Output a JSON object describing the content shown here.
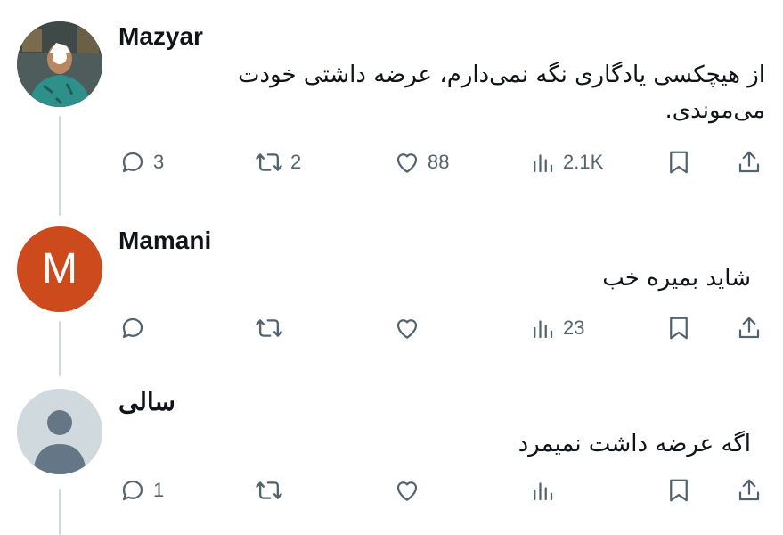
{
  "replies": [
    {
      "author": "Mazyar",
      "avatar_letter": "",
      "text_line1": "از هیچکسی یادگاری نگه نمی‌دارم، عرضه داشتی خودت",
      "text_line2": "می‌موندی.",
      "counts": {
        "reply": "3",
        "repost": "2",
        "like": "88",
        "views": "2.1K"
      }
    },
    {
      "author": "Mamani",
      "avatar_letter": "M",
      "text_line1": "شاید بمیره خب",
      "counts": {
        "reply": "",
        "repost": "",
        "like": "",
        "views": "23"
      }
    },
    {
      "author": "سالی",
      "avatar_letter": "",
      "text_line1": "اگه عرضه داشت نمیمرد",
      "counts": {
        "reply": "1",
        "repost": "",
        "like": "",
        "views": ""
      }
    }
  ],
  "icons": {
    "reply": "speech-bubble",
    "repost": "repost-arrows",
    "like": "heart",
    "views": "bar-chart",
    "bookmark": "bookmark",
    "share": "share-upload"
  },
  "colors": {
    "action_gray": "#536471",
    "thread_line": "#cfd9de",
    "mamani_avatar": "#cc4a1c"
  }
}
